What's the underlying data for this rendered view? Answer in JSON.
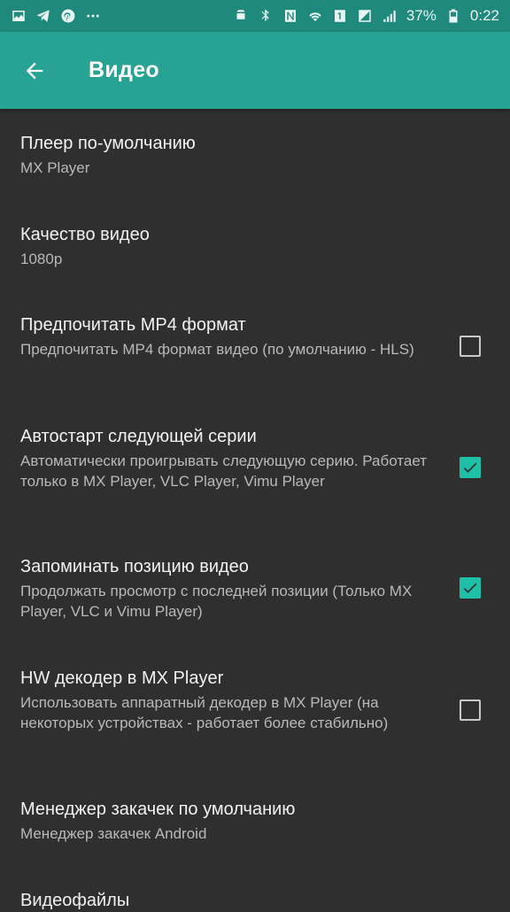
{
  "statusbar": {
    "battery_percent": "37%",
    "time": "0:22",
    "left_icons": [
      "image-icon",
      "telegram-icon",
      "pinterest-icon",
      "more-dots-icon"
    ],
    "right_icons": [
      "android-icon",
      "bluetooth-icon",
      "nfc-icon",
      "wifi-icon",
      "sim-1-icon",
      "signal-icon",
      "signal-icon-2",
      "battery-icon"
    ]
  },
  "appbar": {
    "title": "Видео",
    "color": "#26a392"
  },
  "settings": [
    {
      "title": "Плеер по-умолчанию",
      "subtitle": "MX Player",
      "checkbox": null
    },
    {
      "title": "Качество видео",
      "subtitle": "1080p",
      "checkbox": null
    },
    {
      "title": "Предпочитать MP4 формат",
      "subtitle": "Предпочитать MP4 формат видео (по умолчанию - HLS)",
      "checkbox": false
    },
    {
      "title": "Автостарт следующей серии",
      "subtitle": "Автоматически проигрывать следующую серию. Работает только в MX Player, VLC Player, Vimu Player",
      "checkbox": true
    },
    {
      "title": "Запоминать позицию видео",
      "subtitle": "Продолжать просмотр с последней позиции (Только MX Player, VLC и Vimu Player)",
      "checkbox": true
    },
    {
      "title": "HW декодер в MX Player",
      "subtitle": "Использовать аппаратный декодер в MX Player (на некоторых устройствах - работает более стабильно)",
      "checkbox": false
    },
    {
      "title": "Менеджер закачек по умолчанию",
      "subtitle": "Менеджер закачек Android",
      "checkbox": null
    },
    {
      "title": "Видеофайлы",
      "subtitle": "",
      "checkbox": null
    }
  ],
  "accent_color": "#1fbfa8"
}
